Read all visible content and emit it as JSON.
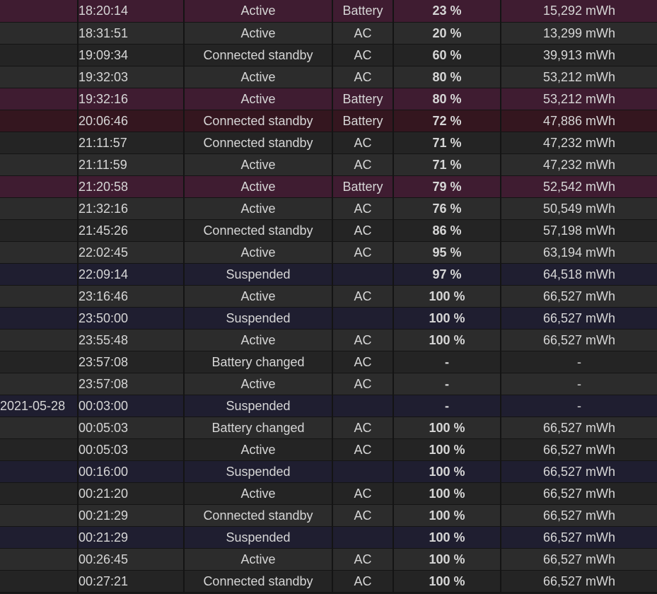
{
  "rows": [
    {
      "date": "",
      "time": "18:20:14",
      "state": "Active",
      "source": "Battery",
      "percent": "23 %",
      "capacity": "15,292 mWh",
      "kind": "battery"
    },
    {
      "date": "",
      "time": "18:31:51",
      "state": "Active",
      "source": "AC",
      "percent": "20 %",
      "capacity": "13,299 mWh",
      "kind": "ac"
    },
    {
      "date": "",
      "time": "19:09:34",
      "state": "Connected standby",
      "source": "AC",
      "percent": "60 %",
      "capacity": "39,913 mWh",
      "kind": "ac"
    },
    {
      "date": "",
      "time": "19:32:03",
      "state": "Active",
      "source": "AC",
      "percent": "80 %",
      "capacity": "53,212 mWh",
      "kind": "ac"
    },
    {
      "date": "",
      "time": "19:32:16",
      "state": "Active",
      "source": "Battery",
      "percent": "80 %",
      "capacity": "53,212 mWh",
      "kind": "battery"
    },
    {
      "date": "",
      "time": "20:06:46",
      "state": "Connected standby",
      "source": "Battery",
      "percent": "72 %",
      "capacity": "47,886 mWh",
      "kind": "battery cs"
    },
    {
      "date": "",
      "time": "21:11:57",
      "state": "Connected standby",
      "source": "AC",
      "percent": "71 %",
      "capacity": "47,232 mWh",
      "kind": "ac"
    },
    {
      "date": "",
      "time": "21:11:59",
      "state": "Active",
      "source": "AC",
      "percent": "71 %",
      "capacity": "47,232 mWh",
      "kind": "ac"
    },
    {
      "date": "",
      "time": "21:20:58",
      "state": "Active",
      "source": "Battery",
      "percent": "79 %",
      "capacity": "52,542 mWh",
      "kind": "battery"
    },
    {
      "date": "",
      "time": "21:32:16",
      "state": "Active",
      "source": "AC",
      "percent": "76 %",
      "capacity": "50,549 mWh",
      "kind": "ac"
    },
    {
      "date": "",
      "time": "21:45:26",
      "state": "Connected standby",
      "source": "AC",
      "percent": "86 %",
      "capacity": "57,198 mWh",
      "kind": "ac"
    },
    {
      "date": "",
      "time": "22:02:45",
      "state": "Active",
      "source": "AC",
      "percent": "95 %",
      "capacity": "63,194 mWh",
      "kind": "ac"
    },
    {
      "date": "",
      "time": "22:09:14",
      "state": "Suspended",
      "source": "",
      "percent": "97 %",
      "capacity": "64,518 mWh",
      "kind": "suspended"
    },
    {
      "date": "",
      "time": "23:16:46",
      "state": "Active",
      "source": "AC",
      "percent": "100 %",
      "capacity": "66,527 mWh",
      "kind": "ac"
    },
    {
      "date": "",
      "time": "23:50:00",
      "state": "Suspended",
      "source": "",
      "percent": "100 %",
      "capacity": "66,527 mWh",
      "kind": "suspended"
    },
    {
      "date": "",
      "time": "23:55:48",
      "state": "Active",
      "source": "AC",
      "percent": "100 %",
      "capacity": "66,527 mWh",
      "kind": "ac"
    },
    {
      "date": "",
      "time": "23:57:08",
      "state": "Battery changed",
      "source": "AC",
      "percent": "-",
      "capacity": "-",
      "kind": "ac"
    },
    {
      "date": "",
      "time": "23:57:08",
      "state": "Active",
      "source": "AC",
      "percent": "-",
      "capacity": "-",
      "kind": "ac"
    },
    {
      "date": "2021-05-28",
      "time": "00:03:00",
      "state": "Suspended",
      "source": "",
      "percent": "-",
      "capacity": "-",
      "kind": "suspended"
    },
    {
      "date": "",
      "time": "00:05:03",
      "state": "Battery changed",
      "source": "AC",
      "percent": "100 %",
      "capacity": "66,527 mWh",
      "kind": "ac"
    },
    {
      "date": "",
      "time": "00:05:03",
      "state": "Active",
      "source": "AC",
      "percent": "100 %",
      "capacity": "66,527 mWh",
      "kind": "ac"
    },
    {
      "date": "",
      "time": "00:16:00",
      "state": "Suspended",
      "source": "",
      "percent": "100 %",
      "capacity": "66,527 mWh",
      "kind": "suspended"
    },
    {
      "date": "",
      "time": "00:21:20",
      "state": "Active",
      "source": "AC",
      "percent": "100 %",
      "capacity": "66,527 mWh",
      "kind": "ac"
    },
    {
      "date": "",
      "time": "00:21:29",
      "state": "Connected standby",
      "source": "AC",
      "percent": "100 %",
      "capacity": "66,527 mWh",
      "kind": "ac"
    },
    {
      "date": "",
      "time": "00:21:29",
      "state": "Suspended",
      "source": "",
      "percent": "100 %",
      "capacity": "66,527 mWh",
      "kind": "suspended"
    },
    {
      "date": "",
      "time": "00:26:45",
      "state": "Active",
      "source": "AC",
      "percent": "100 %",
      "capacity": "66,527 mWh",
      "kind": "ac"
    },
    {
      "date": "",
      "time": "00:27:21",
      "state": "Connected standby",
      "source": "AC",
      "percent": "100 %",
      "capacity": "66,527 mWh",
      "kind": "ac"
    }
  ]
}
